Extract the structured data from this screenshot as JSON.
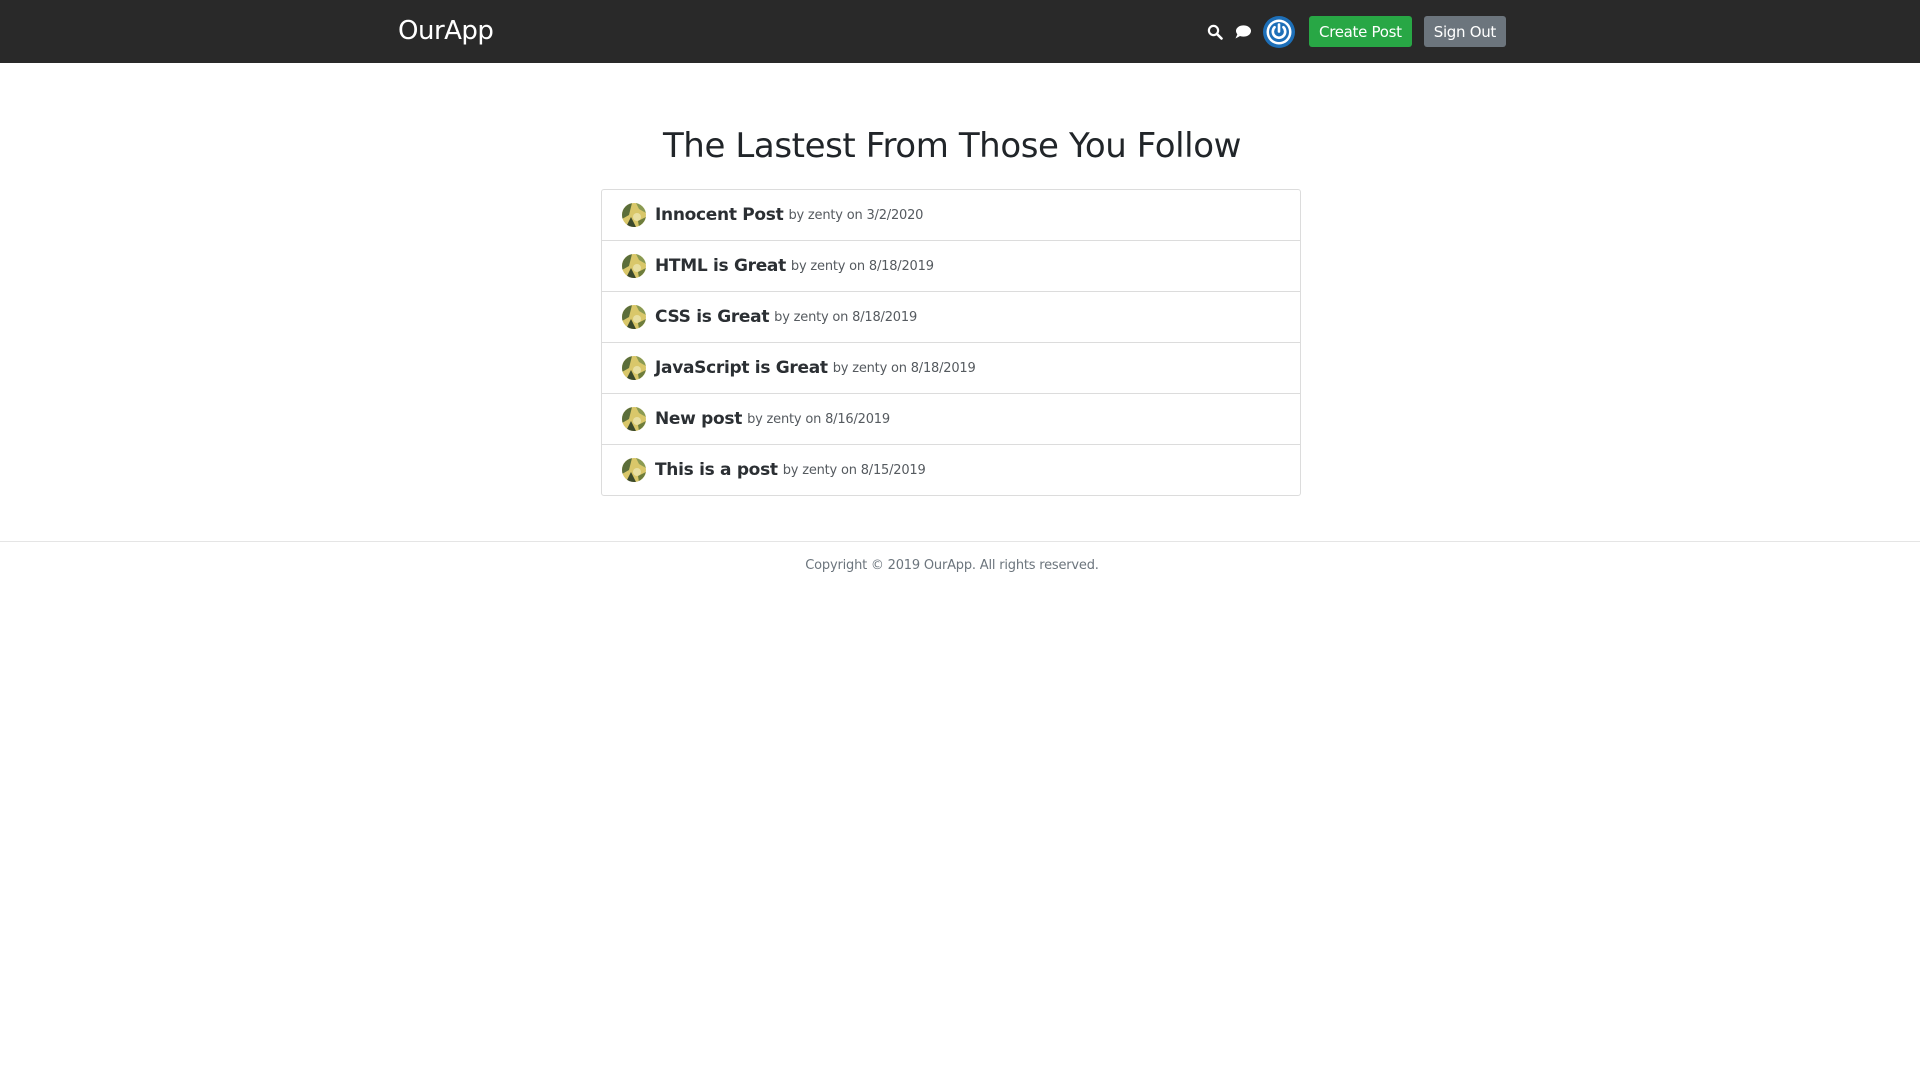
{
  "header": {
    "brand": "OurApp",
    "create_post_label": "Create Post",
    "sign_out_label": "Sign Out",
    "icons": {
      "search": "search-icon",
      "chat": "chat-icon",
      "avatar": "user-avatar-power-icon"
    }
  },
  "main": {
    "title": "The Lastest From Those You Follow",
    "posts": [
      {
        "title": "Innocent Post",
        "meta": "by zenty on 3/2/2020"
      },
      {
        "title": "HTML is Great",
        "meta": "by zenty on 8/18/2019"
      },
      {
        "title": "CSS is Great",
        "meta": "by zenty on 8/18/2019"
      },
      {
        "title": "JavaScript is Great",
        "meta": "by zenty on 8/18/2019"
      },
      {
        "title": "New post",
        "meta": "by zenty on 8/16/2019"
      },
      {
        "title": "This is a post",
        "meta": "by zenty on 8/15/2019"
      }
    ]
  },
  "footer": {
    "copyright": "Copyright © 2019 OurApp. All rights reserved."
  },
  "colors": {
    "header_bg": "#292929",
    "create_post": "#28a745",
    "sign_out": "#6c757d",
    "avatar_ring": "#1d6fb8"
  }
}
